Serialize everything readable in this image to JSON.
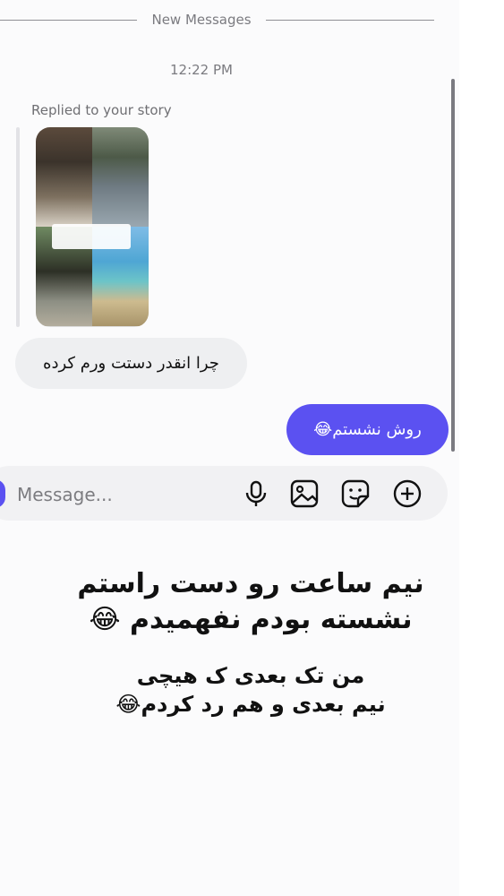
{
  "divider": {
    "label": "New Messages"
  },
  "timestamp": "12:22 PM",
  "story": {
    "caption": "Replied to your story"
  },
  "messages": {
    "incoming": "چرا انقدر دستت ورم کرده",
    "outgoing": "روش نشستم😂"
  },
  "composer": {
    "placeholder": "Message...",
    "icons": [
      "microphone-icon",
      "image-icon",
      "sticker-icon",
      "plus-icon"
    ]
  },
  "overlay_caption": {
    "line1": "نیم ساعت رو دست راستم",
    "line2": "نشسته بودم نفهمیدم 😂",
    "line3": "من تک بعدی ک هیچی",
    "line4": "نیم بعدی و هم رد کردم😂"
  },
  "colors": {
    "accent": "#5b51f1",
    "incoming_bubble": "#eeeff1",
    "composer_bg": "#f1f1f3"
  }
}
